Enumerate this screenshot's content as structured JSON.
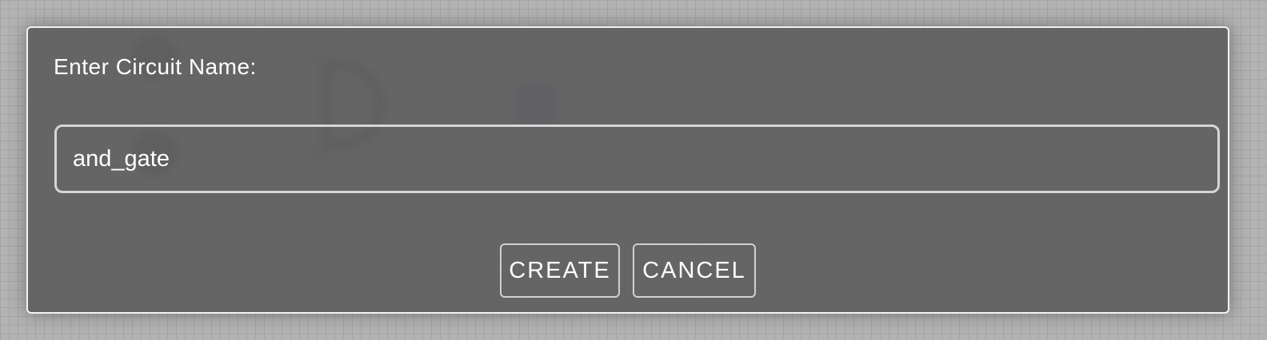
{
  "dialog": {
    "title": "Enter Circuit Name:",
    "input_value": "and_gate",
    "create_label": "CREATE",
    "cancel_label": "CANCEL"
  },
  "colors": {
    "dialog_background": "#5f5f5f",
    "dialog_border": "#f2f2f2",
    "text": "#ffffff",
    "canvas_background": "#b3b3b3",
    "wire": "#4e7a3a",
    "output_node": "#5a52b4"
  }
}
